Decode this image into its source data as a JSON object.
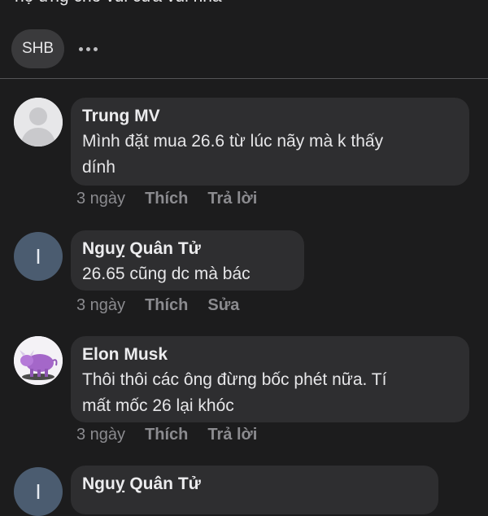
{
  "post": {
    "top_text": "họ ứng cho vui cửa vui nhá",
    "tag": "SHB"
  },
  "comments": [
    {
      "author": "Trung MV",
      "text_lines": [
        "Mình đặt mua 26.6 từ lúc nãy mà k thấy",
        "dính"
      ],
      "time": "3 ngày",
      "like": "Thích",
      "action": "Trả lời",
      "avatar": "default-profile-icon"
    },
    {
      "author": "Nguỵ Quân Tử",
      "text_lines": [
        "26.65 cũng dc mà bác"
      ],
      "time": "3 ngày",
      "like": "Thích",
      "action": "Sửa",
      "avatar_letter": "I"
    },
    {
      "author": "Elon Musk",
      "text_lines": [
        "Thôi thôi các ông đừng bốc phét nữa. Tí",
        "mất mốc 26 lại khóc"
      ],
      "time": "3 ngày",
      "like": "Thích",
      "action": "Trả lời",
      "avatar": "purple-bull-photo"
    },
    {
      "author": "Nguỵ Quân Tử",
      "avatar_letter": "I"
    }
  ]
}
